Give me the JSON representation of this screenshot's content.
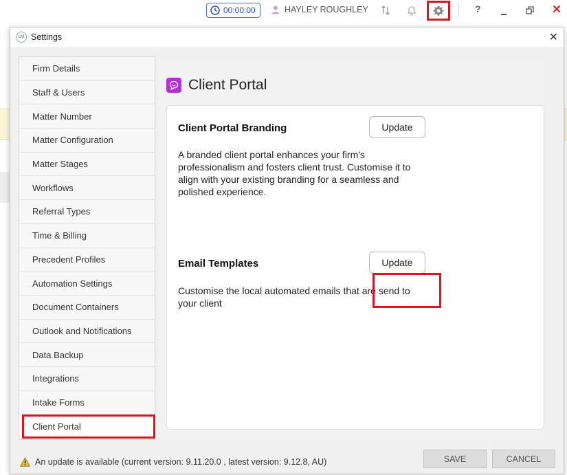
{
  "topbar": {
    "timer": "00:00:00",
    "user_name": "HAYLEY ROUGHLEY",
    "help_label": "?",
    "icons": [
      "clock-icon",
      "user-icon",
      "sync-icon",
      "bell-icon",
      "gear-icon",
      "minimize-icon",
      "restore-icon",
      "close-icon"
    ],
    "accent_color": "#e0141e"
  },
  "dialog": {
    "title": "Settings",
    "close_label": "✕"
  },
  "sidebar": {
    "items": [
      {
        "label": "Firm Details"
      },
      {
        "label": "Staff & Users"
      },
      {
        "label": "Matter Number"
      },
      {
        "label": "Matter Configuration"
      },
      {
        "label": "Matter Stages"
      },
      {
        "label": "Workflows"
      },
      {
        "label": "Referral Types"
      },
      {
        "label": "Time & Billing"
      },
      {
        "label": "Precedent Profiles"
      },
      {
        "label": "Automation Settings"
      },
      {
        "label": "Document Containers"
      },
      {
        "label": "Outlook and Notifications"
      },
      {
        "label": "Data Backup"
      },
      {
        "label": "Integrations"
      },
      {
        "label": "Intake Forms"
      },
      {
        "label": "Client Portal"
      }
    ],
    "active": "Client Portal"
  },
  "content": {
    "title": "Client Portal",
    "icon_color": "#b42fd4",
    "branding": {
      "heading": "Client Portal Branding",
      "button": "Update",
      "description": "A branded client portal enhances your firm's professionalism and fosters client trust. Customise it to align with your existing branding for a seamless and polished experience."
    },
    "email": {
      "heading": "Email Templates",
      "button": "Update",
      "description": "Customise the local automated emails that are send to your client"
    }
  },
  "footer": {
    "update_notice": "An update is available (current version: 9.11.20.0 , latest version: 9.12.8, AU)",
    "save": "SAVE",
    "cancel": "CANCEL"
  }
}
